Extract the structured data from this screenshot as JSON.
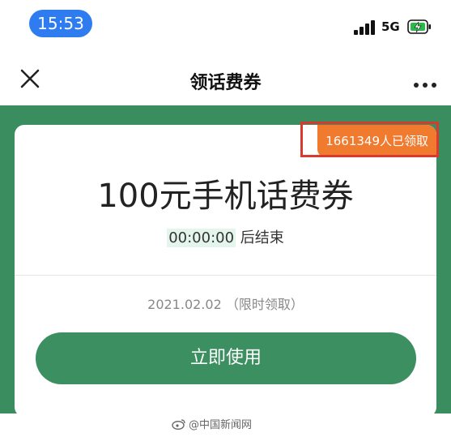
{
  "status_bar": {
    "time": "15:53",
    "network": "5G",
    "signal_bars": 4,
    "battery_icon": "battery-charging-icon",
    "colors": {
      "time_pill": "#2f7bf0",
      "battery": "#2db84b"
    }
  },
  "nav": {
    "title": "领话费券",
    "close_icon": "close-icon",
    "more_icon": "more-icon"
  },
  "card": {
    "claimed_count": "1661349人已领取",
    "title": "100元手机话费券",
    "countdown_time": "00:00:00",
    "countdown_suffix": "后结束",
    "validity": "2021.02.02 （限时领取）",
    "button_label": "立即使用"
  },
  "watermark": {
    "icon": "weibo-icon",
    "text": "@中国新闻网"
  },
  "colors": {
    "accent_green": "#3b8f60",
    "badge_orange": "#f07a2e",
    "highlight_red": "#d93a2f"
  }
}
